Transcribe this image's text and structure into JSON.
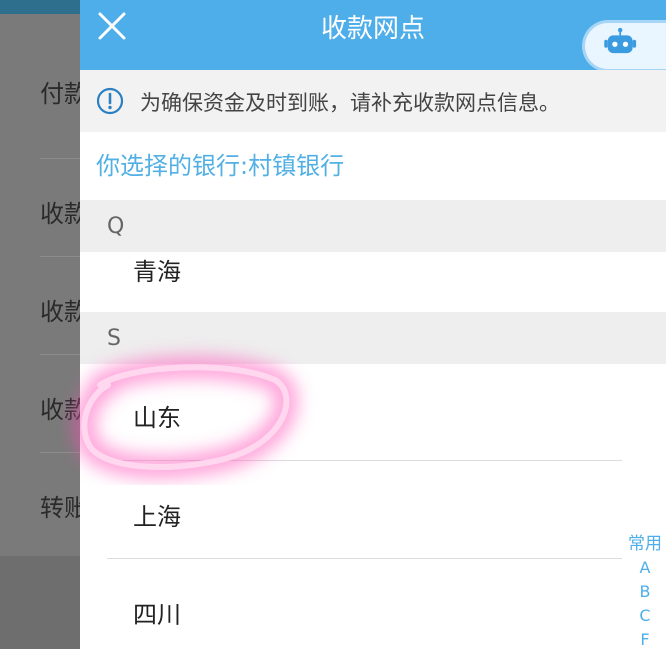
{
  "underlying": {
    "items": [
      "付款",
      "收款",
      "收款",
      "收款",
      "转账"
    ]
  },
  "header": {
    "title": "收款网点"
  },
  "notice": {
    "text": "为确保资金及时到账，请补充收款网点信息。"
  },
  "selected_bank": "你选择的银行:村镇银行",
  "sections": [
    {
      "letter": "Q",
      "items": [
        "青海"
      ]
    },
    {
      "letter": "S",
      "items": [
        "山东",
        "上海",
        "四川"
      ]
    }
  ],
  "index_bar": [
    "常用",
    "A",
    "B",
    "C",
    "F"
  ],
  "colors": {
    "header_bg": "#4eaee9",
    "accent_text": "#52b0e4",
    "highlight": "#ff4fb8"
  },
  "icons": {
    "close": "close-icon",
    "info": "info-icon",
    "assistant": "robot-assistant-icon"
  }
}
